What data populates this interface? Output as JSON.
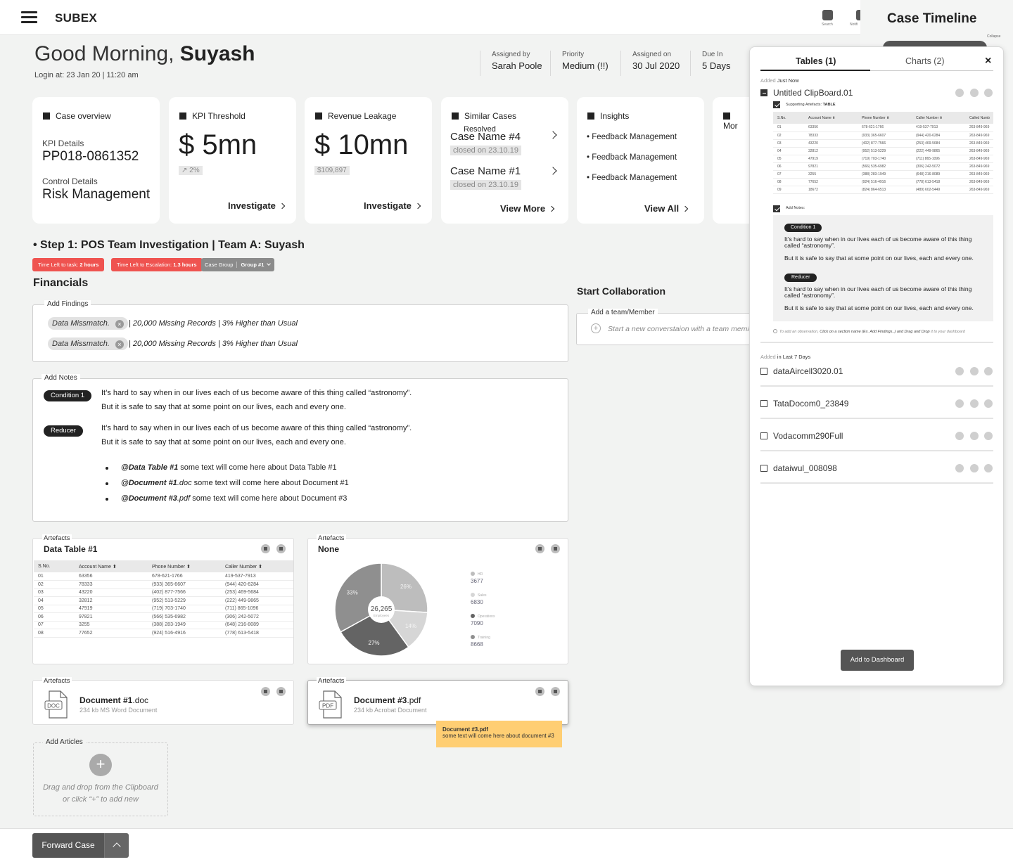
{
  "app": {
    "name": "SUBEX",
    "search_label": "Search",
    "notif_label": "Notifi"
  },
  "greeting": {
    "prefix": "Good Morning,",
    "name": "Suyash",
    "login_label": "Login at:",
    "login_time": "23 Jan 20 | 11:20 am"
  },
  "case_meta": [
    {
      "label": "Assigned by",
      "value": "Sarah Poole"
    },
    {
      "label": "Priority",
      "value": "Medium (!!)"
    },
    {
      "label": "Assigned on",
      "value": "30 Jul 2020"
    },
    {
      "label": "Due In",
      "value": "5 Days"
    }
  ],
  "cards": {
    "overview": {
      "title": "Case overview",
      "kpi_label": "KPI Details",
      "kpi_value": "PP018-0861352",
      "control_label": "Control Details",
      "control_value": "Risk Management"
    },
    "kpi": {
      "title": "KPI Threshold",
      "value": "$ 5mn",
      "change": "↗ 2%",
      "link": "Investigate"
    },
    "leakage": {
      "title": "Revenue Leakage",
      "value": "$ 10mn",
      "sub": "$109,897",
      "link": "Investigate"
    },
    "similar": {
      "title": "Similar Cases",
      "subtitle": "Resolved",
      "items": [
        {
          "name": "Case Name #4",
          "closed": "closed on 23.10.19"
        },
        {
          "name": "Case Name #1",
          "closed": "closed on 23.10.19"
        }
      ],
      "link": "View More"
    },
    "insights": {
      "title": "Insights",
      "items": [
        "• Feedback Management",
        "• Feedback Management",
        "• Feedback Management"
      ],
      "link": "View All"
    },
    "more": {
      "title": "Mor"
    }
  },
  "step": {
    "title": "• Step 1: POS Team Investigation |  Team A: Suyash",
    "time_task_label": "Time Left to task:",
    "time_task": "2 hours",
    "time_esc_label": "Time Left to Escalation:",
    "time_esc": "1.3 hours",
    "group_label": "Case Group",
    "group_value": "Group #1"
  },
  "financials": {
    "title": "Financials"
  },
  "findings": {
    "legend": "Add Findings",
    "rows": [
      {
        "tag": "Data Missmatch.",
        "text": "|  20,000 Missing Records  |  3% Higher than Usual"
      },
      {
        "tag": "Data Missmatch.",
        "text": "|  20,000 Missing Records  |  3% Higher than Usual"
      }
    ]
  },
  "notes": {
    "legend": "Add Notes",
    "entries": [
      {
        "tag": "Condition 1",
        "line1": "It’s hard to say when in our lives each of us become aware of this thing called “astronomy”.",
        "line2": "But it is safe to say that at some point on our lives, each and every one."
      },
      {
        "tag": "Reducer",
        "line1": "It’s hard to say when in our lives each of us become aware of this thing called “astronomy”.",
        "line2": "But it is safe to say that at some point on our lives, each and every one."
      }
    ],
    "bullets": [
      {
        "ref": "@Data Table #1",
        "text": " some text will come here about Data Table #1"
      },
      {
        "ref": "@Document #1",
        "ext": ".doc",
        "text": " some text will come here about Document #1"
      },
      {
        "ref": "@Document #3",
        "ext": ".pdf",
        "text": " some text will come here about Document #3"
      }
    ]
  },
  "collab": {
    "title": "Start Collaboration",
    "legend": "Add a team/Member",
    "placeholder": "Start a new converstaion with a  team member"
  },
  "artefacts": {
    "label": "Artefacts",
    "table": {
      "title": "Data Table #1",
      "columns": [
        "S.No.",
        "Account Name",
        "Phone Number",
        "Caller Number"
      ],
      "rows": [
        [
          "01",
          "63356",
          "678-621-1766",
          "419-537-7913"
        ],
        [
          "02",
          "78333",
          "(933) 365-6607",
          "(944) 420-6284"
        ],
        [
          "03",
          "43220",
          "(402) 877-7566",
          "(253) 469-5684"
        ],
        [
          "04",
          "32812",
          "(952) 513-5229",
          "(222) 449-9865"
        ],
        [
          "05",
          "47919",
          "(719) 703-1740",
          "(711) 865-1096"
        ],
        [
          "06",
          "97821",
          "(566) 535-6982",
          "(306) 242-5072"
        ],
        [
          "07",
          "3255",
          "(388) 283-1949",
          "(648) 216-8089"
        ],
        [
          "08",
          "77652",
          "(924) 516-4916",
          "(778) 613-5418"
        ]
      ]
    },
    "chart_title": "None",
    "doc1": {
      "name": "Document #1",
      "ext": ".doc",
      "meta": "234 kb MS Word Document",
      "icon": "DOC"
    },
    "doc3": {
      "name": "Document #3",
      "ext": ".pdf",
      "meta": "234 kb Acrobat Document",
      "icon": "PDF"
    },
    "tooltip": {
      "title": "Document #3.pdf",
      "text": "some text will come here about document #3"
    }
  },
  "chart_data": {
    "type": "pie",
    "center_value": "26,265",
    "center_label": "Employees",
    "slices": [
      {
        "name": "HR",
        "label": "26%",
        "percent": 26,
        "value": 3677,
        "color": "#bdbdbd"
      },
      {
        "name": "Sales",
        "label": "14%",
        "percent": 14,
        "value": 6830,
        "color": "#d6d6d6"
      },
      {
        "name": "Operations",
        "label": "27%",
        "percent": 27,
        "value": 7090,
        "color": "#646464"
      },
      {
        "name": "Training",
        "label": "33%",
        "percent": 33,
        "value": 8668,
        "color": "#8f8f8f"
      }
    ]
  },
  "articles": {
    "legend": "Add Articles",
    "hint1": "Drag and drop from the Clipboard",
    "hint2": "or click “+” to add new"
  },
  "footer": {
    "forward": "Forward Case"
  },
  "timeline": {
    "title": "Case Timeline",
    "collapse": "Collapse"
  },
  "clipboard": {
    "tab_tables": "Tables (1)",
    "tab_charts": "Charts (2)",
    "added_label": "Added",
    "added_when": "Just Now",
    "item_title": "Untitled ClipBoard.01",
    "support_label": "Supporting Artefacts:",
    "support_value": "TABLE",
    "table_columns": [
      "S.No.",
      "Account Name",
      "Phone Number",
      "Caller Number",
      "Called Numb"
    ],
    "table_rows": [
      [
        "01",
        "63356",
        "678-621-1766",
        "419-537-7913",
        "263-849-969"
      ],
      [
        "02",
        "78333",
        "(933) 365-6607",
        "(944) 420-6284",
        "263-849-969"
      ],
      [
        "03",
        "43220",
        "(402) 877-7566",
        "(253) 469-5684",
        "263-849-969"
      ],
      [
        "04",
        "32812",
        "(952) 513-5229",
        "(222) 449-9865",
        "263-849-969"
      ],
      [
        "05",
        "47919",
        "(719) 703-1740",
        "(711) 865-1096",
        "263-849-969"
      ],
      [
        "06",
        "97821",
        "(566) 535-6982",
        "(306) 242-5072",
        "263-849-969"
      ],
      [
        "07",
        "3255",
        "(388) 283-1949",
        "(648) 216-8089",
        "263-849-969"
      ],
      [
        "08",
        "77652",
        "(924) 516-4916",
        "(778) 613-5418",
        "263-849-969"
      ],
      [
        "09",
        "18672",
        "(824) 864-6513",
        "(489) 602-5449",
        "263-849-969"
      ]
    ],
    "notes_label": "Add Notes:",
    "notes": [
      {
        "tag": "Condition 1",
        "p1": "It’s hard to say when in our lives each of us become aware of this thing called “astronomy”.",
        "p2": "But it is safe to say that at some point on our lives, each and every one."
      },
      {
        "tag": "Reducer",
        "p1": "It’s hard to say when in our lives each of us become aware of this thing called “astronomy”.",
        "p2": "But it is safe to say that at some point on our lives, each and every one."
      }
    ],
    "hint_prefix": "To add an observation,",
    "hint_main": "Click on a section name (Ex. Add Findings..) and Drag and Drop",
    "hint_suffix": "it to your dashboard",
    "recent_label": "Added",
    "recent_when": "in Last 7 Days",
    "recent": [
      "dataAircell3020.01",
      "TataDocom0_23849",
      "Vodacomm290Full",
      "dataiwul_008098"
    ],
    "add_button": "Add to Dashboard"
  }
}
